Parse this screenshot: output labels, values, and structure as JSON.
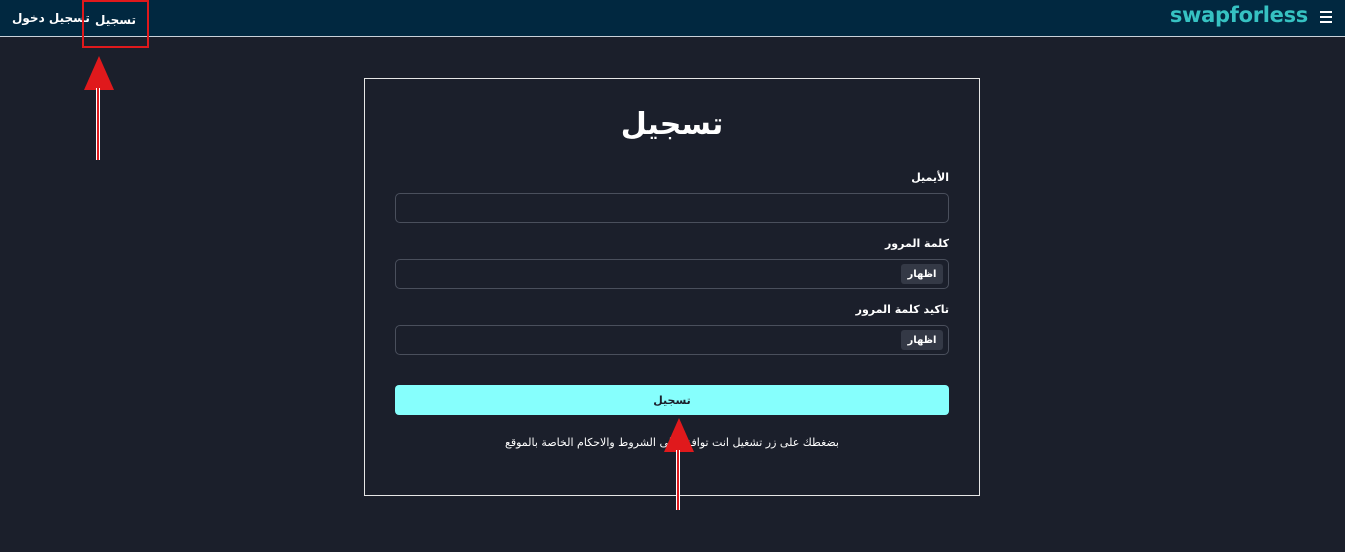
{
  "header": {
    "brand": "swapforless",
    "nav": {
      "register": "تسجيل",
      "login": "تسجيل دخول"
    }
  },
  "form": {
    "title": "تسجيل",
    "email_label": "الأيميل",
    "email_value": "",
    "password_label": "كلمة المرور",
    "password_value": "",
    "confirm_label": "تاكيد كلمة المرور",
    "confirm_value": "",
    "show_label": "اظهار",
    "submit_label": "تسجيل",
    "terms_text": "بضغطك على زر تشغيل انت توافق على الشروط والاحكام الخاصة بالموقع"
  },
  "colors": {
    "background": "#1b1f2b",
    "header": "#012840",
    "brand": "#36c2c2",
    "submit": "#86fffd",
    "annotation": "#e0191c"
  },
  "icons": [
    "menu-icon"
  ]
}
